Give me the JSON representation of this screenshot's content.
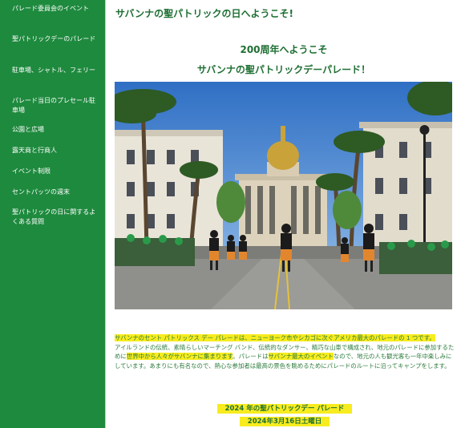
{
  "sidebar": {
    "items": [
      {
        "label": "パレード委員会のイベント"
      },
      {
        "label": "聖パトリックデーのパレード"
      },
      {
        "label": "駐車場、シャトル、フェリー"
      },
      {
        "label": "パレード当日のプレセール駐車場"
      },
      {
        "label": "公園と広場"
      },
      {
        "label": "露天商と行商人"
      },
      {
        "label": "イベント制限"
      },
      {
        "label": "セントパッツの週末"
      },
      {
        "label": "聖パトリックの日に関するよくある質問"
      }
    ]
  },
  "main": {
    "title": "サバンナの聖パトリックの日へようこそ!",
    "sub1": "200周年へようこそ",
    "sub2": "サバンナの聖パトリックデーパレード！",
    "para1": "サバンナのセント パトリックス デー パレードは、ニューヨーク市やシカゴに次ぐアメリカ最大のパレードの 1 つです。",
    "para2_a": "アイルランドの伝統、素晴らしいマーチング バンド、伝統的なダンサー、精巧な山車で構成され、地元のパレードに参加するために",
    "para2_hl1": "世界中から人々がサバンナに集まります",
    "para2_b": "。パレードは",
    "para2_hl2": "サバンナ最大のイベント",
    "para2_c": "なので、地元の人も観光客も一年中楽しみにしています。あまりにも有名なので、熱心な参加者は最高の景色を眺めるためにパレードのルートに沿ってキャンプをします。",
    "bottom1": "2024 年の聖パトリックデー パレード",
    "bottom2": "2024年3月16日土曜日"
  }
}
